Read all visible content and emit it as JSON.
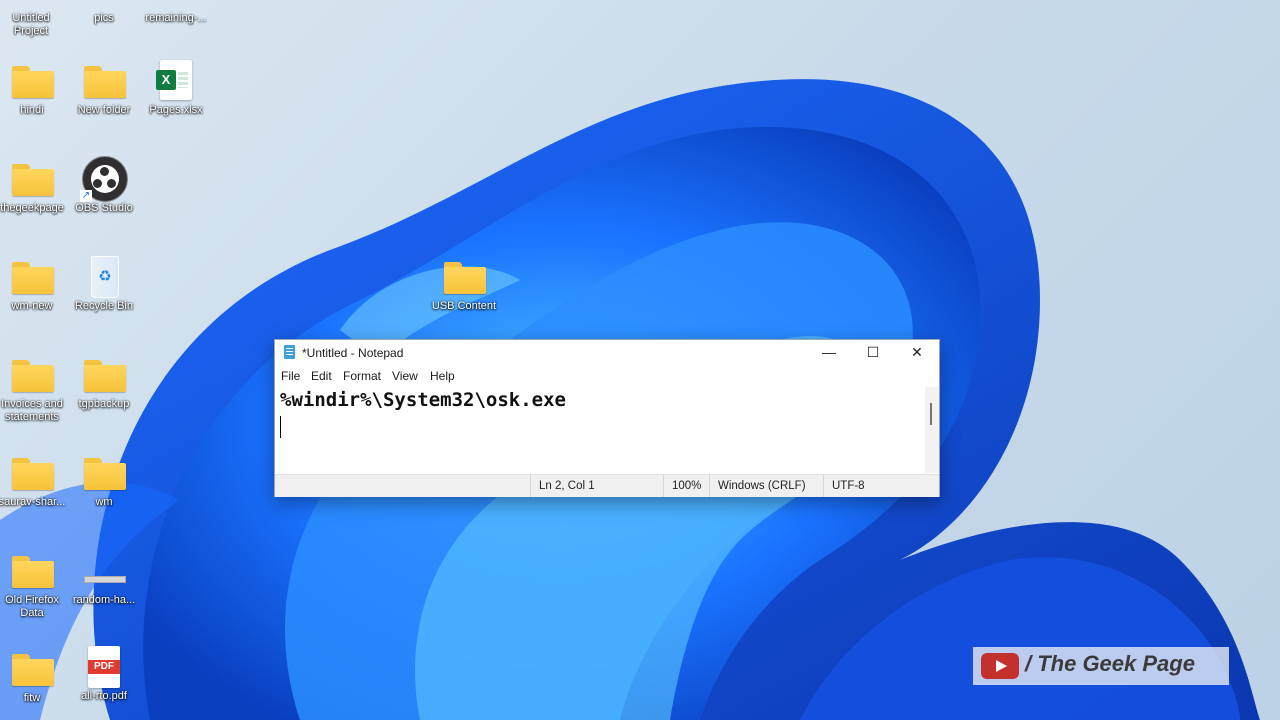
{
  "desktop": {
    "icons": [
      {
        "label": "Untitled\nProject"
      },
      {
        "label": "pics"
      },
      {
        "label": "remaining-..."
      },
      {
        "label": "hindi"
      },
      {
        "label": "New folder"
      },
      {
        "label": "Pages.xlsx"
      },
      {
        "label": "thegeekpage"
      },
      {
        "label": "OBS Studio"
      },
      {
        "label": "wm-new"
      },
      {
        "label": "Recycle Bin"
      },
      {
        "label": "USB Content"
      },
      {
        "label": "Invoices and\nstatements"
      },
      {
        "label": "tgpbackup"
      },
      {
        "label": "saurav-shar..."
      },
      {
        "label": "wm"
      },
      {
        "label": "Old Firefox\nData"
      },
      {
        "label": "random-ha..."
      },
      {
        "label": "fitw"
      },
      {
        "label": "all-rto.pdf"
      }
    ]
  },
  "notepad": {
    "title": "*Untitled - Notepad",
    "window_controls": {
      "minimize": "—",
      "maximize": "☐",
      "close": "✕"
    },
    "menu": [
      "File",
      "Edit",
      "Format",
      "View",
      "Help"
    ],
    "content_line1": "%windir%\\System32\\osk.exe",
    "status": {
      "position": "Ln 2, Col 1",
      "zoom": "100%",
      "line_endings": "Windows (CRLF)",
      "encoding": "UTF-8"
    }
  },
  "watermark": {
    "text": "/ The Geek Page"
  },
  "colors": {
    "accent": "#1565e0",
    "folder": "#f7c23b"
  }
}
